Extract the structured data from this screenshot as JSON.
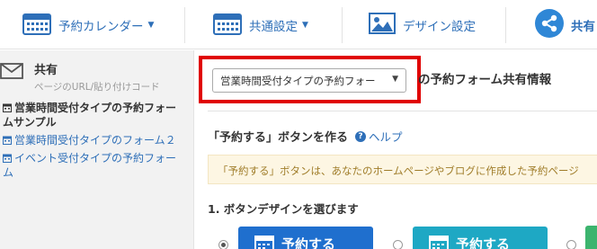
{
  "nav": {
    "items": [
      {
        "label": "予約カレンダー",
        "icon": "calendar-icon",
        "has_caret": true
      },
      {
        "label": "共通設定",
        "icon": "calendar-grid-icon",
        "has_caret": true
      },
      {
        "label": "デザイン設定",
        "icon": "image-icon",
        "has_caret": false
      },
      {
        "label": "共有",
        "icon": "share-icon",
        "has_caret": false
      }
    ],
    "accent_color": "#2e6fb8",
    "share_icon_color": "#2f87d6"
  },
  "sidebar": {
    "title": "共有",
    "subtitle": "ページのURL/貼り付けコード",
    "icon": "envelope-icon",
    "items": [
      {
        "label_line1": "営業時間受付タイプの予約フォー",
        "label_line2": "ムサンプル",
        "active": true
      },
      {
        "label_line1": "営業時間受付タイプのフォーム２",
        "label_line2": "",
        "active": false
      },
      {
        "label_line1": "イベント受付タイプの予約フォー",
        "label_line2": "ム",
        "active": false
      }
    ]
  },
  "main": {
    "form_select": {
      "value": "営業時間受付タイプの予約フォー",
      "highlight_color": "#e00000"
    },
    "section_title": "の予約フォーム共有情報",
    "button_heading": "「予約する」ボタンを作る",
    "help_label": "ヘルプ",
    "notice": "「予約する」ボタンは、あなたのホームページやブログに作成した予約ページ",
    "step1_title": "1. ボタンデザインを選びます",
    "button_samples": [
      {
        "label": "予約する",
        "color": "#1f6fce",
        "selected": true
      },
      {
        "label": "予約する",
        "color": "#1ea8c4",
        "selected": false
      }
    ]
  }
}
